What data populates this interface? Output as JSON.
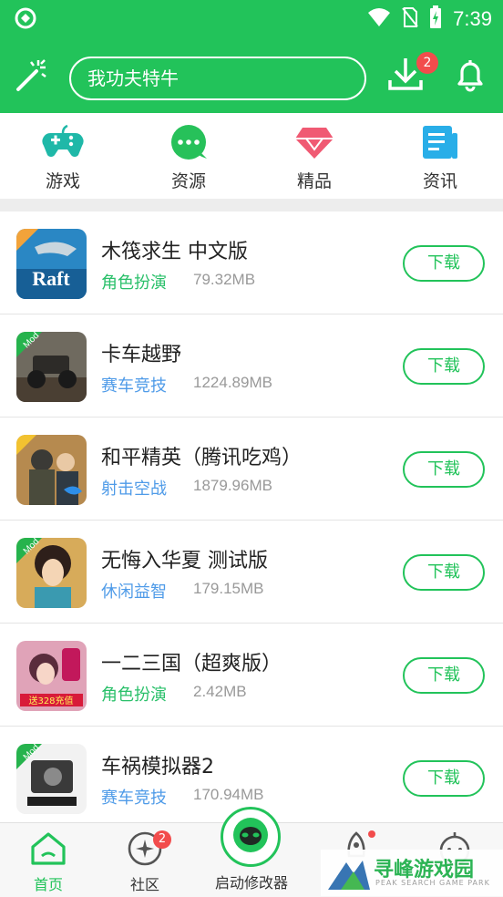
{
  "status": {
    "time": "7:39"
  },
  "header": {
    "search_text": "我功夫特牛",
    "download_badge": "2"
  },
  "categories": [
    {
      "label": "游戏",
      "icon": "gamepad-icon"
    },
    {
      "label": "资源",
      "icon": "chat-dots-icon"
    },
    {
      "label": "精品",
      "icon": "diamond-icon"
    },
    {
      "label": "资讯",
      "icon": "news-icon"
    }
  ],
  "apps": [
    {
      "name": "木筏求生  中文版",
      "genre": "角色扮演",
      "size": "79.32MB",
      "button": "下载",
      "genre_color": "#2ac06a"
    },
    {
      "name": "卡车越野",
      "genre": "赛车竞技",
      "size": "1224.89MB",
      "button": "下载",
      "genre_color": "#4f9be8"
    },
    {
      "name": "和平精英（腾讯吃鸡）",
      "genre": "射击空战",
      "size": "1879.96MB",
      "button": "下载",
      "genre_color": "#4f9be8"
    },
    {
      "name": "无悔入华夏  测试版",
      "genre": "休闲益智",
      "size": "179.15MB",
      "button": "下载",
      "genre_color": "#4f9be8"
    },
    {
      "name": "一二三国（超爽版）",
      "genre": "角色扮演",
      "size": "2.42MB",
      "button": "下载",
      "genre_color": "#2ac06a"
    },
    {
      "name": "车祸模拟器2",
      "genre": "赛车竞技",
      "size": "170.94MB",
      "button": "下载",
      "genre_color": "#4f9be8"
    }
  ],
  "thumb_text": {
    "raft": "Raft",
    "mod": "Mod",
    "num": "送328充值"
  },
  "bottom_nav": {
    "home": "首页",
    "community": "社区",
    "community_badge": "2",
    "launcher": "启动修改器"
  },
  "watermark": {
    "title": "寻峰游戏园",
    "subtitle": "PEAK SEARCH GAME PARK"
  },
  "colors": {
    "brand": "#22c35a",
    "badge": "#f24c4c"
  }
}
